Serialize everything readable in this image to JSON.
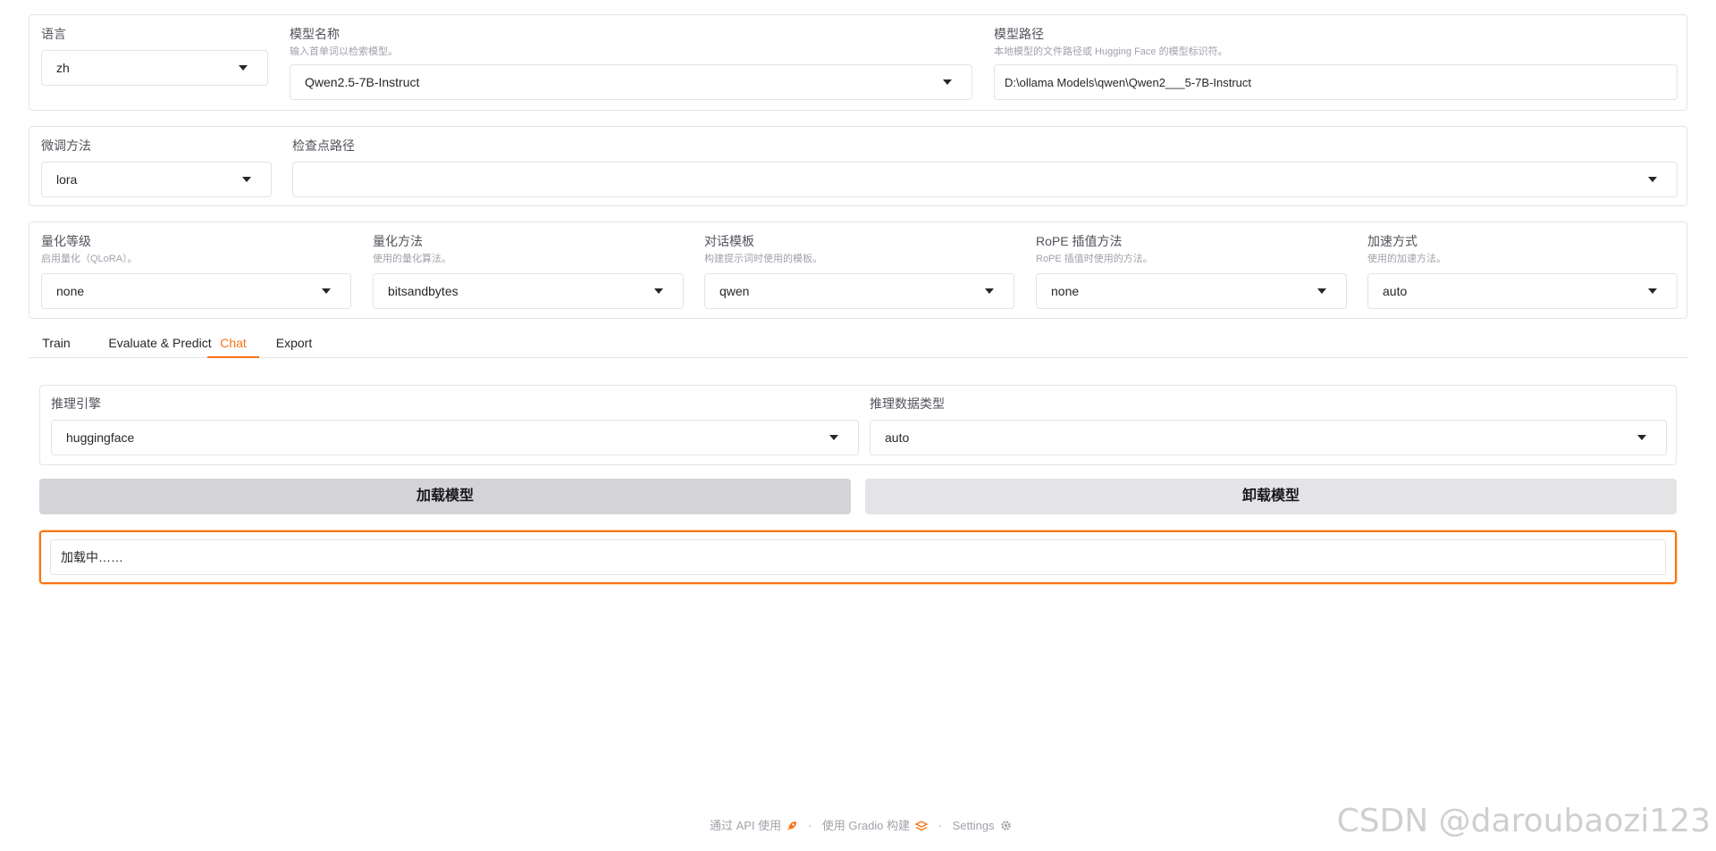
{
  "top_section": {
    "language": {
      "label": "语言",
      "value": "zh"
    },
    "model_name": {
      "label": "模型名称",
      "info": "输入首单词以检索模型。",
      "value": "Qwen2.5-7B-Instruct"
    },
    "model_path": {
      "label": "模型路径",
      "info": "本地模型的文件路径或 Hugging Face 的模型标识符。",
      "value": "D:\\ollama Models\\qwen\\Qwen2___5-7B-Instruct"
    }
  },
  "finetune_section": {
    "method": {
      "label": "微调方法",
      "value": "lora"
    },
    "checkpoint": {
      "label": "检查点路径",
      "value": ""
    }
  },
  "advanced_section": {
    "quant_bit": {
      "label": "量化等级",
      "info": "启用量化（QLoRA）。",
      "value": "none"
    },
    "quant_method": {
      "label": "量化方法",
      "info": "使用的量化算法。",
      "value": "bitsandbytes"
    },
    "template": {
      "label": "对话模板",
      "info": "构建提示词时使用的模板。",
      "value": "qwen"
    },
    "rope": {
      "label": "RoPE 插值方法",
      "info": "RoPE 插值时使用的方法。",
      "value": "none"
    },
    "booster": {
      "label": "加速方式",
      "info": "使用的加速方法。",
      "value": "auto"
    }
  },
  "tabs": [
    {
      "label": "Train"
    },
    {
      "label": "Evaluate & Predict"
    },
    {
      "label": "Chat"
    },
    {
      "label": "Export"
    }
  ],
  "active_tab": "Chat",
  "chat": {
    "infer_backend": {
      "label": "推理引擎",
      "value": "huggingface"
    },
    "infer_dtype": {
      "label": "推理数据类型",
      "value": "auto"
    },
    "load_button": "加载模型",
    "unload_button": "卸载模型",
    "status": "加载中……"
  },
  "footer": {
    "api": "通过 API 使用",
    "gradio": "使用 Gradio 构建",
    "settings": "Settings"
  },
  "watermark": "CSDN @daroubaozi123",
  "colors": {
    "accent": "#f97316",
    "border": "#e4e4e7",
    "muted_text": "#a1a1aa"
  }
}
